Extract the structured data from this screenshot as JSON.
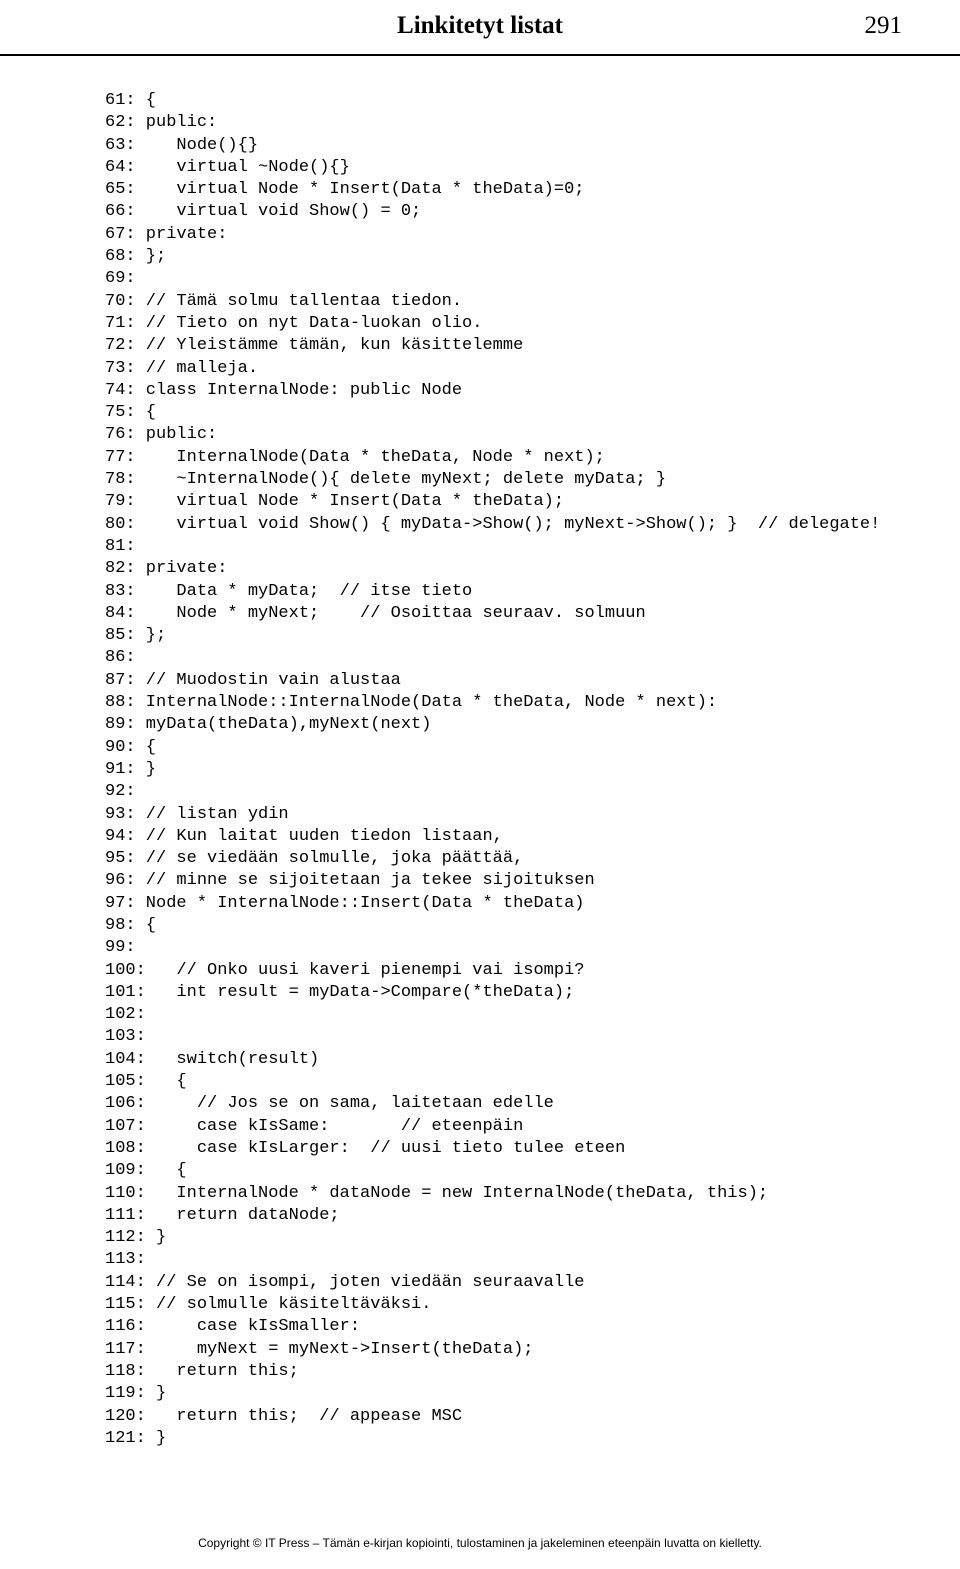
{
  "header": {
    "chapter_title": "Linkitetyt listat",
    "page_number": "291"
  },
  "code_lines": [
    "61: {",
    "62: public:",
    "63:    Node(){}",
    "64:    virtual ~Node(){}",
    "65:    virtual Node * Insert(Data * theData)=0;",
    "66:    virtual void Show() = 0;",
    "67: private:",
    "68: };",
    "69:",
    "70: // Tämä solmu tallentaa tiedon.",
    "71: // Tieto on nyt Data-luokan olio.",
    "72: // Yleistämme tämän, kun käsittelemme",
    "73: // malleja.",
    "74: class InternalNode: public Node",
    "75: {",
    "76: public:",
    "77:    InternalNode(Data * theData, Node * next);",
    "78:    ~InternalNode(){ delete myNext; delete myData; }",
    "79:    virtual Node * Insert(Data * theData);",
    "80:    virtual void Show() { myData->Show(); myNext->Show(); }  // delegate!",
    "81:",
    "82: private:",
    "83:    Data * myData;  // itse tieto",
    "84:    Node * myNext;    // Osoittaa seuraav. solmuun",
    "85: };",
    "86:",
    "87: // Muodostin vain alustaa",
    "88: InternalNode::InternalNode(Data * theData, Node * next):",
    "89: myData(theData),myNext(next)",
    "90: {",
    "91: }",
    "92:",
    "93: // listan ydin",
    "94: // Kun laitat uuden tiedon listaan,",
    "95: // se viedään solmulle, joka päättää,",
    "96: // minne se sijoitetaan ja tekee sijoituksen",
    "97: Node * InternalNode::Insert(Data * theData)",
    "98: {",
    "99:",
    "100:   // Onko uusi kaveri pienempi vai isompi?",
    "101:   int result = myData->Compare(*theData);",
    "102:",
    "103:",
    "104:   switch(result)",
    "105:   {",
    "106:     // Jos se on sama, laitetaan edelle",
    "107:     case kIsSame:       // eteenpäin",
    "108:     case kIsLarger:  // uusi tieto tulee eteen",
    "109:   {",
    "110:   InternalNode * dataNode = new InternalNode(theData, this);",
    "111:   return dataNode;",
    "112: }",
    "113:",
    "114: // Se on isompi, joten viedään seuraavalle",
    "115: // solmulle käsiteltäväksi.",
    "116:     case kIsSmaller:",
    "117:     myNext = myNext->Insert(theData);",
    "118:   return this;",
    "119: }",
    "120:   return this;  // appease MSC",
    "121: }"
  ],
  "footer": "Copyright © IT Press – Tämän e-kirjan kopiointi, tulostaminen ja jakeleminen eteenpäin luvatta on kielletty."
}
